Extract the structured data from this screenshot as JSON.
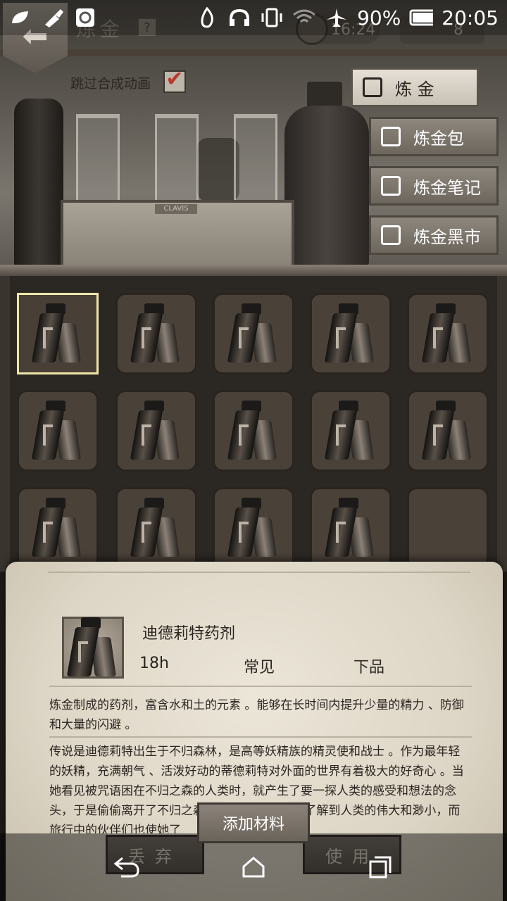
{
  "status_bar": {
    "battery": "90%",
    "time": "20:05",
    "icons": [
      "leaf-icon",
      "brush-icon",
      "gear-badge-icon",
      "fire-icon",
      "headphones-icon",
      "vibrate-icon",
      "wifi-icon",
      "airplane-icon",
      "battery-icon"
    ]
  },
  "header": {
    "title": "炼金",
    "help": "?",
    "timer": "16:24",
    "count": "8"
  },
  "skip_animation_label": "跳过合成动画",
  "scene": {
    "crate_label": "CLAVIS"
  },
  "menu": [
    {
      "label": "炼 金",
      "icon": "alchemy-icon",
      "active": true
    },
    {
      "label": "炼金包",
      "icon": "bag-icon",
      "active": false
    },
    {
      "label": "炼金笔记",
      "icon": "book-icon",
      "active": false
    },
    {
      "label": "炼金黑市",
      "icon": "house-icon",
      "active": false
    }
  ],
  "grid": {
    "rows": 3,
    "cols": 5,
    "filled_slots": 14,
    "selected_index": 0
  },
  "item": {
    "name": "迪德莉特药剂",
    "time": "18h",
    "rarity": "常见",
    "grade": "下品",
    "description": "炼金制成的药剂，富含水和土的元素 。能够在长时间内提升少量的精力 、防御和大量的闪避 。",
    "lore": "传说是迪德莉特出生于不归森林，是高等妖精族的精灵使和战士 。作为最年轻的妖精，充满朝气 、活泼好动的蒂德莉特对外面的世界有着极大的好奇心 。当她看见被咒语困在不归之森的人类时，就产生了要一探人类的感受和想法的念头，于是偷偷离开了不归之森 。人类的社会让她了解到人类的伟大和渺小，而旅行中的伙伴们也使她了"
  },
  "actions": {
    "discard": "丢弃",
    "add_material": "添加材料",
    "use": "使用"
  },
  "nav": {
    "back": "back-icon",
    "home": "home-icon",
    "recents": "recents-icon"
  }
}
